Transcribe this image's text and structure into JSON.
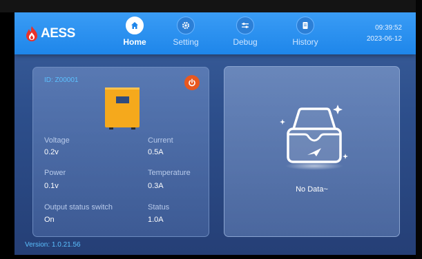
{
  "header": {
    "logo_text": "AESS",
    "time": "09:39:52",
    "date": "2023-06-12"
  },
  "nav": [
    {
      "label": "Home",
      "icon": "home-icon",
      "active": true
    },
    {
      "label": "Setting",
      "icon": "gear-icon",
      "active": false
    },
    {
      "label": "Debug",
      "icon": "sliders-icon",
      "active": false
    },
    {
      "label": "History",
      "icon": "document-icon",
      "active": false
    }
  ],
  "device": {
    "id": "ID: Z00001",
    "fields": [
      {
        "label": "Voltage",
        "value": "0.2v"
      },
      {
        "label": "Current",
        "value": "0.5A"
      },
      {
        "label": "Power",
        "value": "0.1v"
      },
      {
        "label": "Temperature",
        "value": "0.3A"
      },
      {
        "label": "Output status switch",
        "value": "On"
      },
      {
        "label": "Status",
        "value": "1.0A"
      }
    ]
  },
  "empty_state": {
    "text": "No Data~"
  },
  "footer": {
    "version": "Version: 1.0.21.56"
  },
  "colors": {
    "header": "#1e86ea",
    "background": "#2d4f8c",
    "accent_text": "#5cc0ff",
    "power_button": "#e8581f",
    "device_body": "#f5a91c",
    "logo_red": "#e8322a"
  }
}
